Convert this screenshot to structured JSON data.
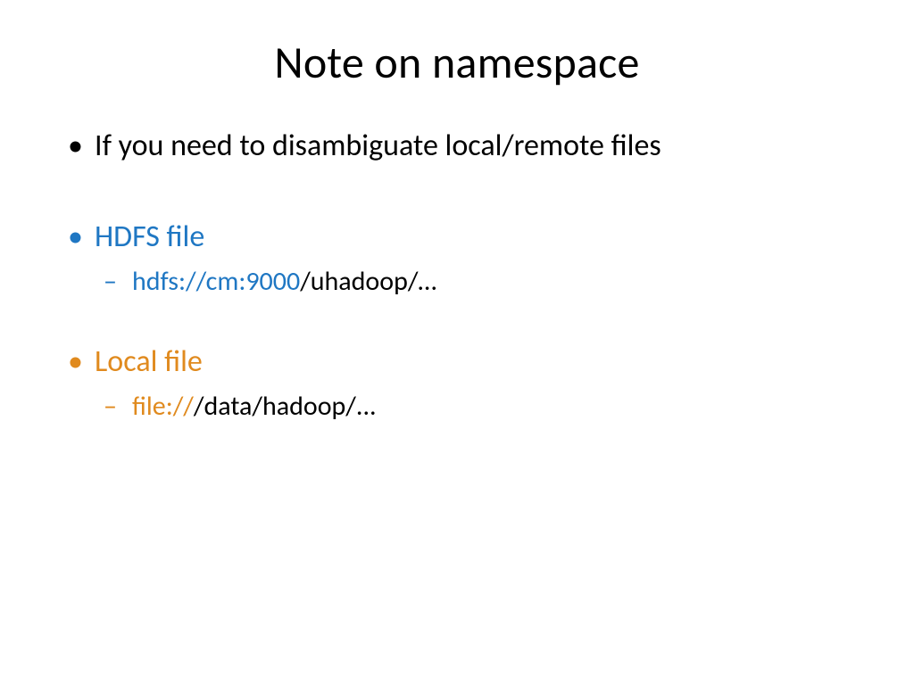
{
  "title": "Note on namespace",
  "bullet1": "If you need to disambiguate local/remote files",
  "hdfs_label": "HDFS file",
  "hdfs_prefix": "hdfs://cm:9000",
  "hdfs_path": "/uhadoop/…",
  "local_label": "Local file",
  "local_prefix": "file://",
  "local_path": "/data/hadoop/...",
  "colors": {
    "blue": "#1f77c3",
    "orange": "#e08a1e"
  }
}
